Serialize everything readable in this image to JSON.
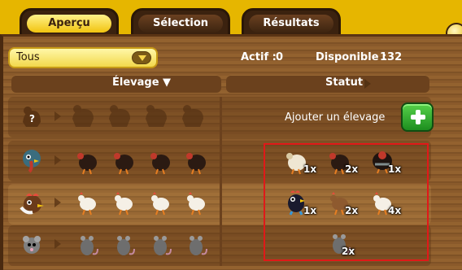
{
  "tabs": [
    {
      "label": "Aperçu",
      "active": true
    },
    {
      "label": "Sélection",
      "active": false
    },
    {
      "label": "Résultats",
      "active": false
    }
  ],
  "filter": {
    "selected": "Tous"
  },
  "counters": {
    "actif_label": "Actif :",
    "actif_value": "0",
    "disponible_label": "Disponible :",
    "disponible_value": "132"
  },
  "headers": {
    "elevage": "Élevage ▼",
    "statut": "Statut"
  },
  "add_row": {
    "label": "Ajouter un élevage",
    "question": "?"
  },
  "rows": [
    {
      "animal": "turkey",
      "status": [
        {
          "count": "1x"
        },
        {
          "count": "2x"
        },
        {
          "count": "1x"
        }
      ]
    },
    {
      "animal": "chicken",
      "status": [
        {
          "count": "1x"
        },
        {
          "count": "2x"
        },
        {
          "count": "4x"
        }
      ]
    },
    {
      "animal": "rat",
      "status": [
        {
          "count": "2x"
        }
      ]
    }
  ],
  "colors": {
    "accent_yellow": "#e6b600",
    "wood": "#8a5a2b",
    "add_green": "#2fb02c",
    "highlight_red": "#e01919"
  }
}
